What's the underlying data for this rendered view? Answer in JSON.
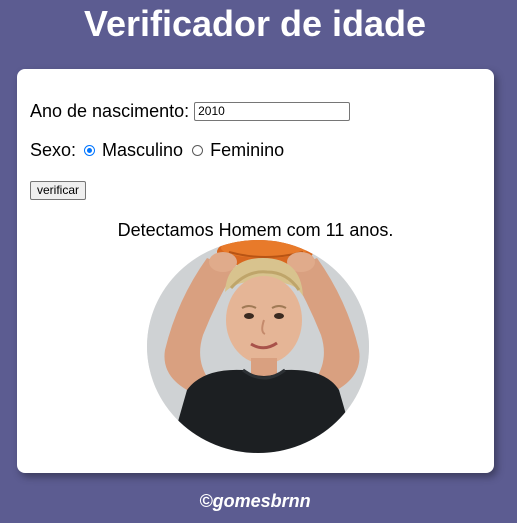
{
  "header": {
    "title": "Verificador de idade"
  },
  "form": {
    "year_label": "Ano de nascimento:",
    "year_value": "2010",
    "sex_label": "Sexo:",
    "sex_options": [
      {
        "label": "Masculino",
        "checked": true
      },
      {
        "label": "Feminino",
        "checked": false
      }
    ],
    "verify_label": "verificar"
  },
  "result": {
    "text": "Detectamos Homem com 11 anos.",
    "image_icon": "boy-photo"
  },
  "footer": {
    "credit": "©gomesbrnn"
  },
  "colors": {
    "background": "#5c5c91",
    "card": "#ffffff",
    "radio_accent": "#0075ff"
  }
}
